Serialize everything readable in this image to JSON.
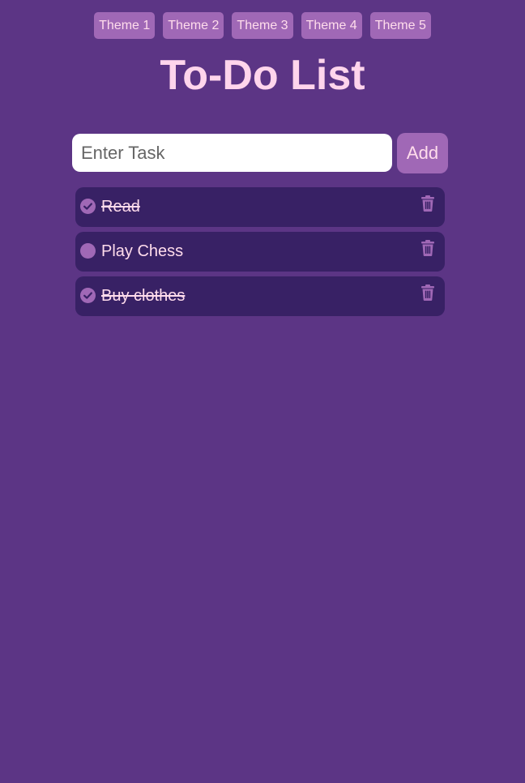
{
  "themes": [
    {
      "label": "Theme 1"
    },
    {
      "label": "Theme 2"
    },
    {
      "label": "Theme 3"
    },
    {
      "label": "Theme 4"
    },
    {
      "label": "Theme 5"
    }
  ],
  "title": "To-Do List",
  "input": {
    "placeholder": "Enter Task",
    "value": ""
  },
  "add_button": {
    "label": "Add"
  },
  "tasks": [
    {
      "text": "Read",
      "completed": true,
      "check_icon": "check-circle-icon",
      "delete_icon": "trash-icon"
    },
    {
      "text": "Play Chess",
      "completed": false,
      "check_icon": "circle-icon",
      "delete_icon": "trash-icon"
    },
    {
      "text": "Buy clothes",
      "completed": true,
      "check_icon": "check-circle-icon",
      "delete_icon": "trash-icon"
    }
  ],
  "colors": {
    "background": "#5c3585",
    "accent": "#a068b6",
    "task_background": "#382165",
    "text": "#ffdcec",
    "title": "#ffd5ec"
  }
}
